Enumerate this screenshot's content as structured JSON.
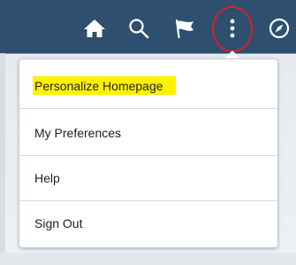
{
  "header": {
    "icons": {
      "home": "home-icon",
      "search": "search-icon",
      "notifications": "flag-icon",
      "actions": "more-vertical-icon",
      "navigator": "compass-icon"
    }
  },
  "menu": {
    "items": [
      {
        "label": "Personalize Homepage"
      },
      {
        "label": "My Preferences"
      },
      {
        "label": "Help"
      },
      {
        "label": "Sign Out"
      }
    ]
  },
  "colors": {
    "header": "#2e4f70",
    "highlight": "#fff200",
    "annotation": "#d9201f"
  }
}
